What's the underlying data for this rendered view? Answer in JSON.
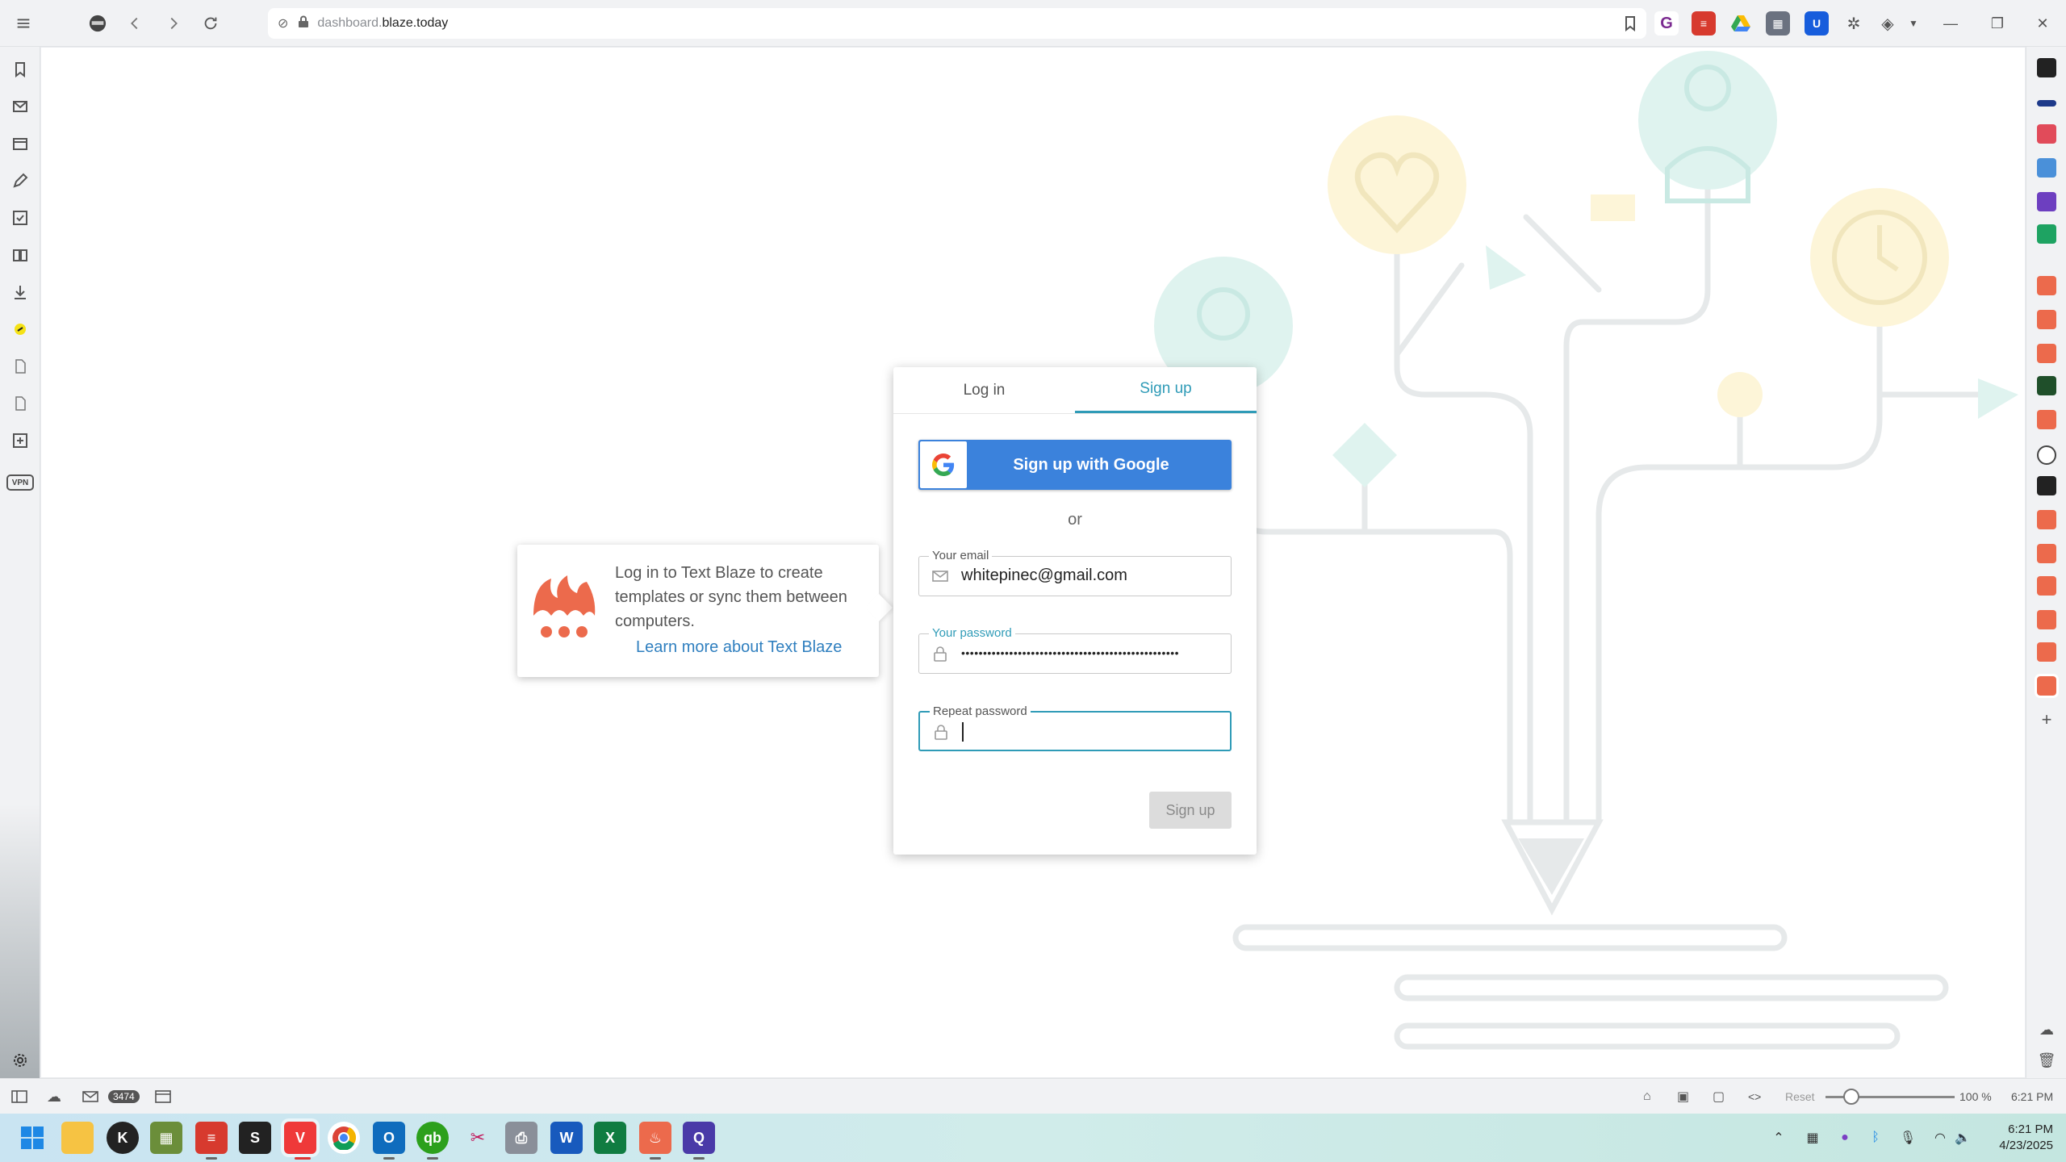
{
  "browser": {
    "url_prefix": "dashboard.",
    "url_domain": "blaze.today",
    "status": {
      "mail_count": "3474",
      "reset_label": "Reset",
      "zoom": "100 %",
      "time": "6:21 PM"
    }
  },
  "auth": {
    "tabs": [
      {
        "label": "Log in",
        "active": false
      },
      {
        "label": "Sign up",
        "active": true
      }
    ],
    "google_button": "Sign up with Google",
    "or_text": "or",
    "email": {
      "label": "Your email",
      "value": "whitepinec@gmail.com"
    },
    "password": {
      "label": "Your password",
      "value": "••••••••••••••••••••••••••••••••••••••••••••••••••"
    },
    "repeat_password": {
      "label": "Repeat password",
      "value": ""
    },
    "submit_button": "Sign up"
  },
  "tooltip": {
    "text": "Log in to Text Blaze to create templates or sync them between computers.",
    "link": "Learn more about Text Blaze"
  },
  "taskbar": {
    "clock_time": "6:21 PM",
    "clock_date": "4/23/2025"
  },
  "colors": {
    "accent": "#2f9bb7",
    "google_blue": "#3b82dc",
    "blaze_orange": "#ec6a4c"
  }
}
